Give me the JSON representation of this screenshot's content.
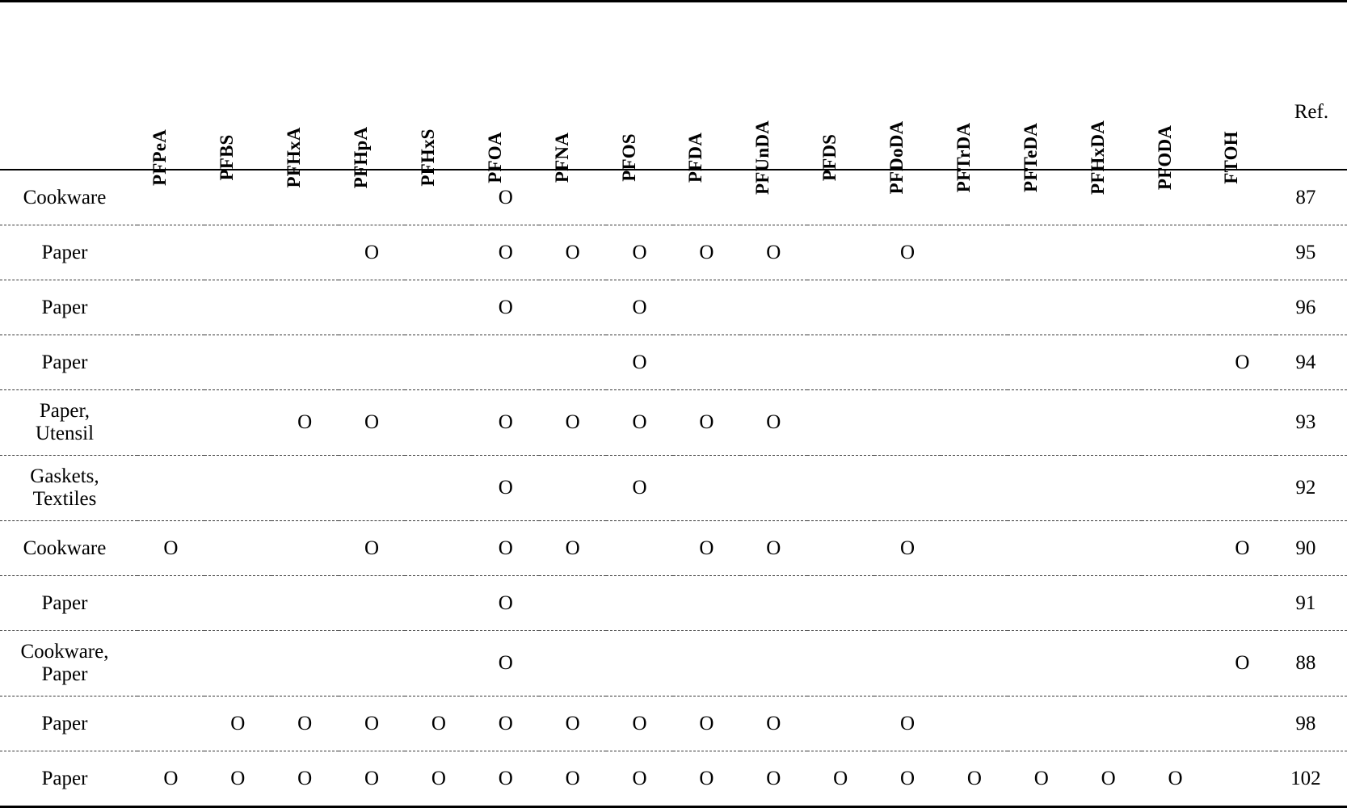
{
  "table": {
    "columns": [
      {
        "key": "category",
        "label": "",
        "type": "rowlabel"
      },
      {
        "key": "PFPeA",
        "label": "PFPeA",
        "type": "chem"
      },
      {
        "key": "PFBS",
        "label": "PFBS",
        "type": "chem"
      },
      {
        "key": "PFHxA",
        "label": "PFHxA",
        "type": "chem"
      },
      {
        "key": "PFHpA",
        "label": "PFHpA",
        "type": "chem"
      },
      {
        "key": "PFHxS",
        "label": "PFHxS",
        "type": "chem"
      },
      {
        "key": "PFOA",
        "label": "PFOA",
        "type": "chem"
      },
      {
        "key": "PFNA",
        "label": "PFNA",
        "type": "chem"
      },
      {
        "key": "PFOS",
        "label": "PFOS",
        "type": "chem"
      },
      {
        "key": "PFDA",
        "label": "PFDA",
        "type": "chem"
      },
      {
        "key": "PFUnDA",
        "label": "PFUnDA",
        "type": "chem"
      },
      {
        "key": "PFDS",
        "label": "PFDS",
        "type": "chem"
      },
      {
        "key": "PFDoDA",
        "label": "PFDoDA",
        "type": "chem"
      },
      {
        "key": "PFTrDA",
        "label": "PFTrDA",
        "type": "chem"
      },
      {
        "key": "PFTeDA",
        "label": "PFTeDA",
        "type": "chem"
      },
      {
        "key": "PFHxDA",
        "label": "PFHxDA",
        "type": "chem"
      },
      {
        "key": "PFODA",
        "label": "PFODA",
        "type": "chem"
      },
      {
        "key": "FTOH",
        "label": "FTOH",
        "type": "chem"
      },
      {
        "key": "Ref",
        "label": "Ref.",
        "type": "ref"
      }
    ],
    "mark_symbol": "O",
    "empty_symbol": "",
    "rows": [
      {
        "category": "Cookware",
        "ref": "87",
        "marks": [
          "",
          "",
          "",
          "",
          "",
          "O",
          "",
          "",
          "",
          "",
          "",
          "",
          "",
          "",
          "",
          "",
          ""
        ]
      },
      {
        "category": "Paper",
        "ref": "95",
        "marks": [
          "",
          "",
          "",
          "O",
          "",
          "O",
          "O",
          "O",
          "O",
          "O",
          "",
          "O",
          "",
          "",
          "",
          "",
          ""
        ]
      },
      {
        "category": "Paper",
        "ref": "96",
        "marks": [
          "",
          "",
          "",
          "",
          "",
          "O",
          "",
          "O",
          "",
          "",
          "",
          "",
          "",
          "",
          "",
          "",
          ""
        ]
      },
      {
        "category": "Paper",
        "ref": "94",
        "marks": [
          "",
          "",
          "",
          "",
          "",
          "",
          "",
          "O",
          "",
          "",
          "",
          "",
          "",
          "",
          "",
          "",
          "O"
        ]
      },
      {
        "category": "Paper,\nUtensil",
        "ref": "93",
        "marks": [
          "",
          "",
          "O",
          "O",
          "",
          "O",
          "O",
          "O",
          "O",
          "O",
          "",
          "",
          "",
          "",
          "",
          "",
          ""
        ]
      },
      {
        "category": "Gaskets,\nTextiles",
        "ref": "92",
        "marks": [
          "",
          "",
          "",
          "",
          "",
          "O",
          "",
          "O",
          "",
          "",
          "",
          "",
          "",
          "",
          "",
          "",
          ""
        ]
      },
      {
        "category": "Cookware",
        "ref": "90",
        "marks": [
          "O",
          "",
          "",
          "O",
          "",
          "O",
          "O",
          "",
          "O",
          "O",
          "",
          "O",
          "",
          "",
          "",
          "",
          "O"
        ]
      },
      {
        "category": "Paper",
        "ref": "91",
        "marks": [
          "",
          "",
          "",
          "",
          "",
          "O",
          "",
          "",
          "",
          "",
          "",
          "",
          "",
          "",
          "",
          "",
          ""
        ]
      },
      {
        "category": "Cookware,\nPaper",
        "ref": "88",
        "marks": [
          "",
          "",
          "",
          "",
          "",
          "O",
          "",
          "",
          "",
          "",
          "",
          "",
          "",
          "",
          "",
          "",
          "O"
        ]
      },
      {
        "category": "Paper",
        "ref": "98",
        "marks": [
          "",
          "O",
          "O",
          "O",
          "O",
          "O",
          "O",
          "O",
          "O",
          "O",
          "",
          "O",
          "",
          "",
          "",
          "",
          ""
        ]
      },
      {
        "category": "Paper",
        "ref": "102",
        "marks": [
          "O",
          "O",
          "O",
          "O",
          "O",
          "O",
          "O",
          "O",
          "O",
          "O",
          "O",
          "O",
          "O",
          "O",
          "O",
          "O",
          ""
        ]
      }
    ]
  }
}
